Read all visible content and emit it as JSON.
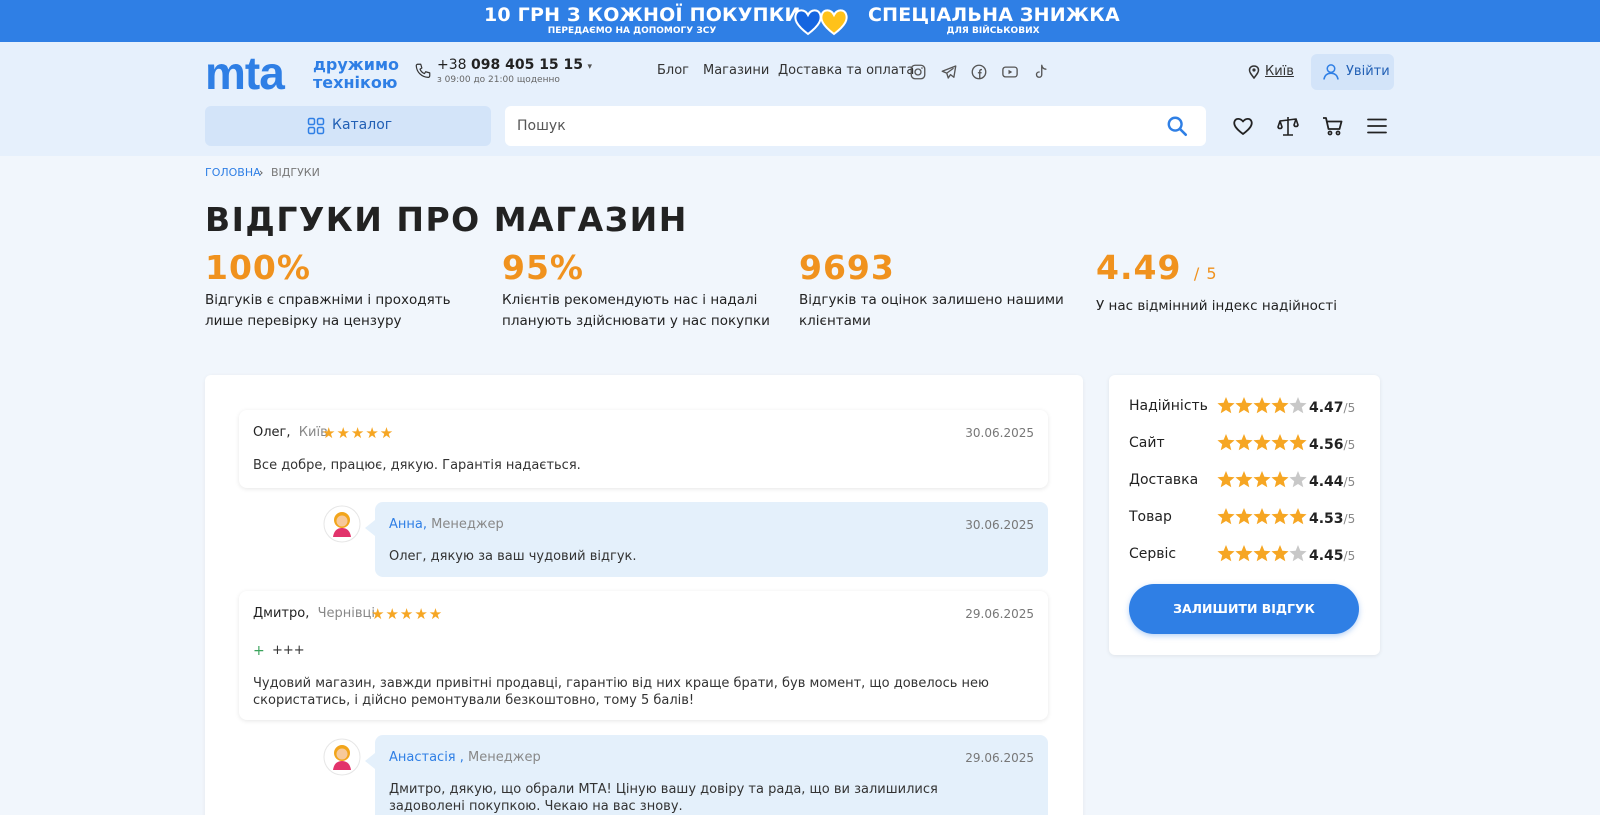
{
  "banner": {
    "left_title": "10 ГРН З КОЖНОЇ ПОКУПКИ",
    "left_sub": "ПЕРЕДАЄМО НА ДОПОМОГУ ЗСУ",
    "right_title": "СПЕЦІАЛЬНА ЗНИЖКА",
    "right_sub": "ДЛЯ ВІЙСЬКОВИХ",
    "color": "#2f7fe5"
  },
  "header": {
    "logo": "mta",
    "slogan_line1": "дружимо",
    "slogan_line2": "технікою",
    "phone_prefix": "+38",
    "phone_number": "098 405 15 15",
    "phone_hours": "з 09:00 до 21:00 щоденно",
    "nav": [
      "Блог",
      "Магазини",
      "Доставка та оплата"
    ],
    "socials": [
      "instagram-icon",
      "telegram-icon",
      "facebook-icon",
      "youtube-icon",
      "tiktok-icon"
    ],
    "city": "Київ",
    "login_label": "Увійти",
    "catalog_label": "Каталог",
    "search_placeholder": "Пошук",
    "icons": [
      "heart-icon",
      "scales-icon",
      "cart-icon",
      "menu-icon"
    ]
  },
  "breadcrumb": {
    "home": "ГОЛОВНА",
    "separator": "›",
    "current": "ВІДГУКИ"
  },
  "page": {
    "title": "ВІДГУКИ ПРО МАГАЗИН"
  },
  "stats": [
    {
      "value": "100%",
      "unit": "",
      "desc": "Відгуків є справжніми і проходять лише перевірку на цензуру"
    },
    {
      "value": "95%",
      "unit": "",
      "desc": "Клієнтів рекомендують нас і надалі планують здійснювати у нас покупки"
    },
    {
      "value": "9693",
      "unit": "",
      "desc": "Відгуків та оцінок залишено нашими клієнтами"
    },
    {
      "value": "4.49",
      "unit": "/ 5",
      "desc": "У нас відмінний індекс надійності"
    }
  ],
  "reviews": [
    {
      "author": "Олег,",
      "city": "Київ",
      "stars": 5,
      "date": "30.06.2025",
      "text": "Все добре, працює, дякую. Гарантія надається.",
      "reply": {
        "name": "Анна,",
        "role": "Менеджер",
        "date": "30.06.2025",
        "text": "Олег, дякую за ваш чудовий відгук."
      }
    },
    {
      "author": "Дмитро,",
      "city": "Чернівці",
      "stars": 5,
      "date": "29.06.2025",
      "plus_mark": "+",
      "plus": "+++",
      "text": "Чудовий магазин, завжди привітні продавці, гарантію від них краще брати, був момент, що довелось нею скористатись, і дійсно ремонтували безкоштовно, тому 5 балів!",
      "reply": {
        "name": "Анастасія ,",
        "role": "Менеджер",
        "date": "29.06.2025",
        "text": "Дмитро, дякую, що обрали МТА! Ціную вашу довіру та рада, що ви залишилися задоволені покупкою. Чекаю на вас знову."
      }
    }
  ],
  "ratings": {
    "max_label": "/5",
    "rows": [
      {
        "label": "Надійність",
        "value": "4.47",
        "filled": 4
      },
      {
        "label": "Сайт",
        "value": "4.56",
        "filled": 5
      },
      {
        "label": "Доставка",
        "value": "4.44",
        "filled": 4
      },
      {
        "label": "Товар",
        "value": "4.53",
        "filled": 5
      },
      {
        "label": "Сервіс",
        "value": "4.45",
        "filled": 4
      }
    ],
    "button_label": "ЗАЛИШИТИ ВІДГУК",
    "star_color": "#f6a623",
    "star_empty_color": "#c8c8c8"
  }
}
